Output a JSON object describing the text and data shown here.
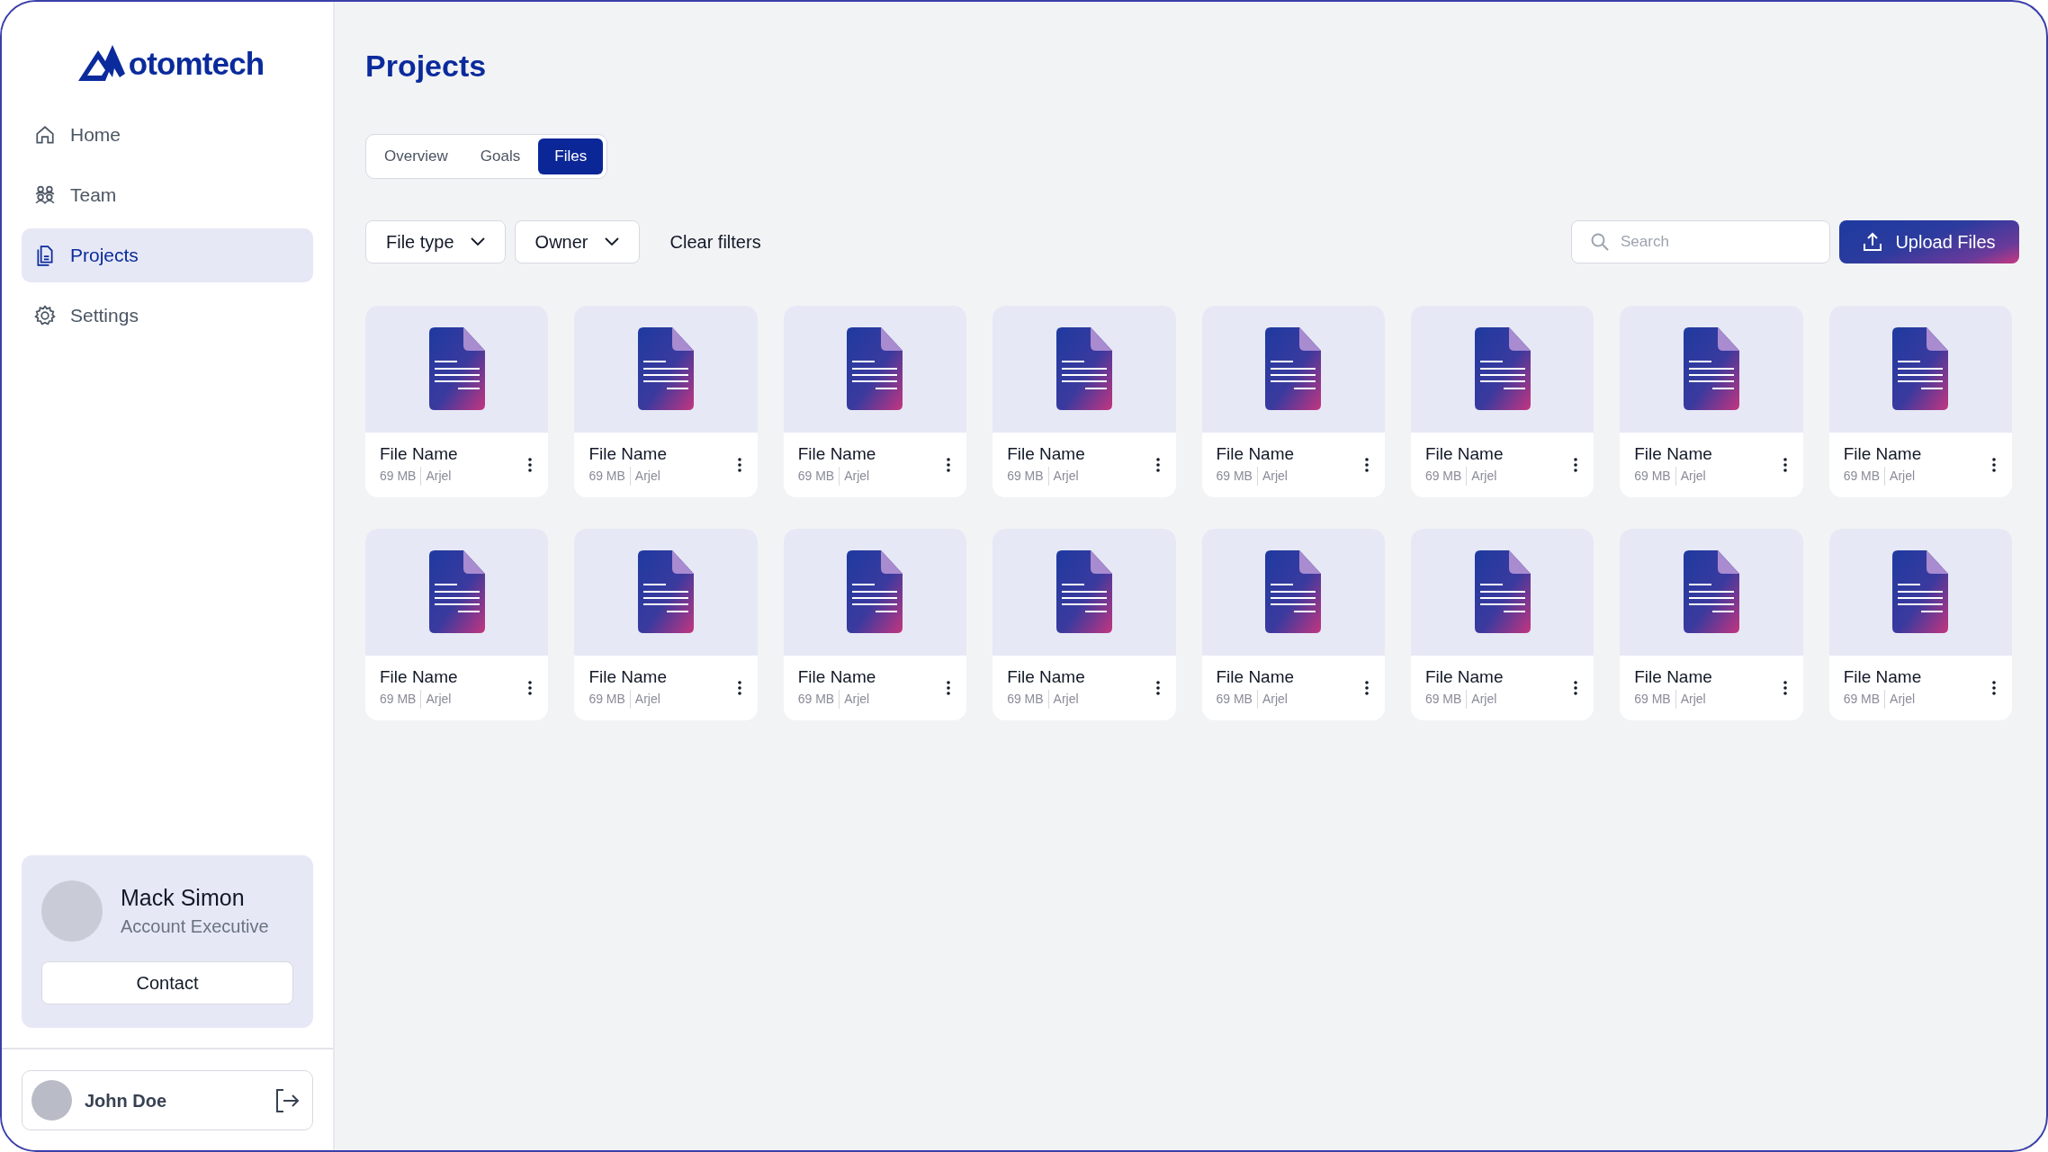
{
  "logo": {
    "text": "otomtech"
  },
  "sidebar": {
    "items": [
      {
        "label": "Home",
        "selected": false
      },
      {
        "label": "Team",
        "selected": false
      },
      {
        "label": "Projects",
        "selected": true
      },
      {
        "label": "Settings",
        "selected": false
      }
    ]
  },
  "contact_card": {
    "name": "Mack Simon",
    "role": "Account Executive",
    "button": "Contact"
  },
  "user": {
    "name": "John Doe"
  },
  "page_title": "Projects",
  "tabs": [
    {
      "label": "Overview",
      "selected": false
    },
    {
      "label": "Goals",
      "selected": false
    },
    {
      "label": "Files",
      "selected": true
    }
  ],
  "filters": [
    {
      "label": "File type"
    },
    {
      "label": "Owner"
    }
  ],
  "clear_filters": "Clear filters",
  "search": {
    "placeholder": "Search"
  },
  "upload_button": "Upload Files",
  "files": [
    {
      "name": "File Name",
      "size": "69 MB",
      "owner": "Arjel"
    },
    {
      "name": "File Name",
      "size": "69 MB",
      "owner": "Arjel"
    },
    {
      "name": "File Name",
      "size": "69 MB",
      "owner": "Arjel"
    },
    {
      "name": "File Name",
      "size": "69 MB",
      "owner": "Arjel"
    },
    {
      "name": "File Name",
      "size": "69 MB",
      "owner": "Arjel"
    },
    {
      "name": "File Name",
      "size": "69 MB",
      "owner": "Arjel"
    },
    {
      "name": "File Name",
      "size": "69 MB",
      "owner": "Arjel"
    },
    {
      "name": "File Name",
      "size": "69 MB",
      "owner": "Arjel"
    },
    {
      "name": "File Name",
      "size": "69 MB",
      "owner": "Arjel"
    },
    {
      "name": "File Name",
      "size": "69 MB",
      "owner": "Arjel"
    },
    {
      "name": "File Name",
      "size": "69 MB",
      "owner": "Arjel"
    },
    {
      "name": "File Name",
      "size": "69 MB",
      "owner": "Arjel"
    },
    {
      "name": "File Name",
      "size": "69 MB",
      "owner": "Arjel"
    },
    {
      "name": "File Name",
      "size": "69 MB",
      "owner": "Arjel"
    },
    {
      "name": "File Name",
      "size": "69 MB",
      "owner": "Arjel"
    },
    {
      "name": "File Name",
      "size": "69 MB",
      "owner": "Arjel"
    }
  ]
}
